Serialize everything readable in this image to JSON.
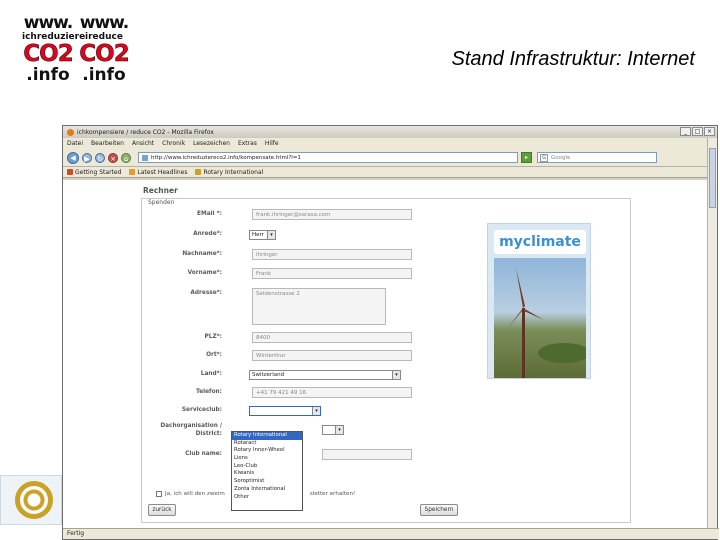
{
  "slide": {
    "title": "Stand Infrastruktur: Internet",
    "logos": [
      {
        "www": "www.",
        "sub": "ichreduziere",
        "co2": "CO2",
        "info": ".info"
      },
      {
        "www": "www.",
        "sub": "ireduce",
        "co2": "CO2",
        "info": ".info"
      }
    ]
  },
  "browser": {
    "window_title": "ichkompensiere / reduce CO2 - Mozilla Firefox",
    "menu": [
      "Datei",
      "Bearbeiten",
      "Ansicht",
      "Chronik",
      "Lesezeichen",
      "Extras",
      "Hilfe"
    ],
    "url": "http://www.ichreduziereco2.info/kompensate.html?l=1",
    "search_placeholder": "Google",
    "bookmarks": [
      "Getting Started",
      "Latest Headlines",
      "Rotary International"
    ],
    "status": "Fertig"
  },
  "page": {
    "heading": "Rechner",
    "legend": "Spenden",
    "fields": {
      "email_label": "EMail *:",
      "email_value": "frank.ihringer@sarasa.com",
      "anrede_label": "Anrede*:",
      "anrede_value": "Herr",
      "nachname_label": "Nachname*:",
      "nachname_value": "Ihringer",
      "vorname_label": "Vorname*:",
      "vorname_value": "Frank",
      "adresse_label": "Adresse*:",
      "adresse_value": "Seidenstrasse 2",
      "plz_label": "PLZ*:",
      "plz_value": "8400",
      "ort_label": "Ort*:",
      "ort_value": "Winterthur",
      "land_label": "Land*:",
      "land_value": "Switzerland",
      "telefon_label": "Telefon:",
      "telefon_value": "+41 79 421 49 16",
      "serviceclub_label": "Serviceclub:",
      "serviceclub_value": "",
      "dach_label_1": "Dachorganisation /",
      "dach_label_2": "District:",
      "clubname_label": "Club name:"
    },
    "dropdown_options": [
      "Rotary International",
      "Rotaract",
      "Rotary Inner-Wheel",
      "Lions",
      "Leo-Club",
      "Kiwanis",
      "Soroptimist",
      "Zonta International",
      "Other"
    ],
    "checkbox_text_left": "Ja, ich will den zweim",
    "checkbox_text_right": "sletter erhalten!",
    "back_button": "zurück",
    "save_button": "Speichern",
    "sidebar_brand": "myclimate"
  },
  "colors": {
    "co2_red": "#e2001a",
    "accent_blue": "#3d8fd1",
    "selection_blue": "#3268c4"
  }
}
